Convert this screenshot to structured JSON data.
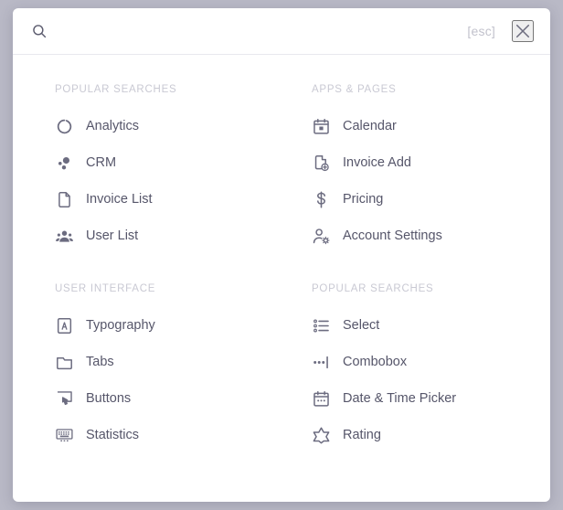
{
  "search": {
    "icon": "search-icon",
    "value": "",
    "placeholder": "",
    "esc_label": "[esc]",
    "close_icon": "close-icon"
  },
  "colors": {
    "backdrop": "#b9b9c6",
    "dialog": "#ffffff",
    "text": "#56566a",
    "muted": "#c9c9d3",
    "icon": "#6c6c80",
    "divider": "#e8e8ee"
  },
  "columns": [
    {
      "sections": [
        {
          "title": "POPULAR SEARCHES",
          "items": [
            {
              "label": "Analytics",
              "icon": "donut-chart-icon"
            },
            {
              "label": "CRM",
              "icon": "bubble-chart-icon"
            },
            {
              "label": "Invoice List",
              "icon": "document-icon"
            },
            {
              "label": "User List",
              "icon": "users-group-icon"
            }
          ]
        },
        {
          "title": "USER INTERFACE",
          "items": [
            {
              "label": "Typography",
              "icon": "letter-a-box-icon"
            },
            {
              "label": "Tabs",
              "icon": "folder-tab-icon"
            },
            {
              "label": "Buttons",
              "icon": "click-cursor-icon"
            },
            {
              "label": "Statistics",
              "icon": "keyboard-icon"
            }
          ]
        }
      ]
    },
    {
      "sections": [
        {
          "title": "APPS & PAGES",
          "items": [
            {
              "label": "Calendar",
              "icon": "calendar-icon"
            },
            {
              "label": "Invoice Add",
              "icon": "document-plus-icon"
            },
            {
              "label": "Pricing",
              "icon": "dollar-sign-icon"
            },
            {
              "label": "Account Settings",
              "icon": "user-gear-icon"
            }
          ]
        },
        {
          "title": "POPULAR SEARCHES",
          "items": [
            {
              "label": "Select",
              "icon": "list-select-icon"
            },
            {
              "label": "Combobox",
              "icon": "dots-caret-icon"
            },
            {
              "label": "Date & Time Picker",
              "icon": "calendar-dots-icon"
            },
            {
              "label": "Rating",
              "icon": "star-outline-icon"
            }
          ]
        }
      ]
    }
  ]
}
